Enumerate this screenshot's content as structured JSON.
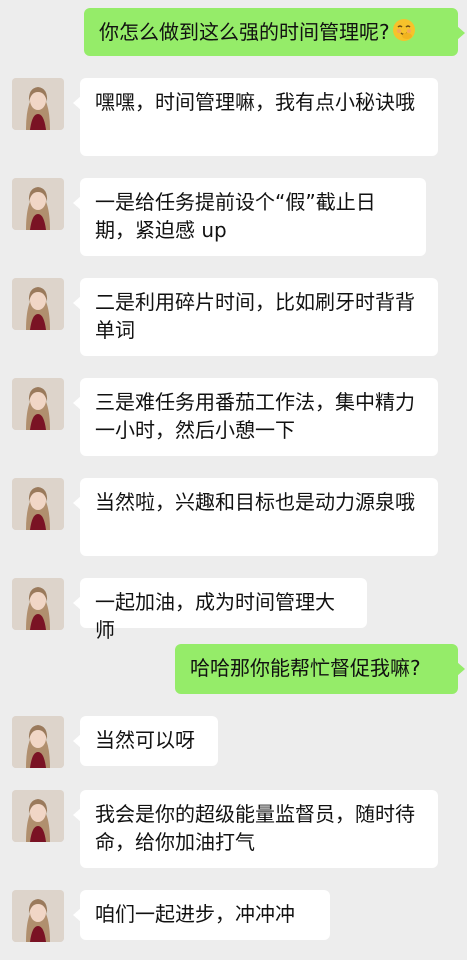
{
  "chat": {
    "messages": [
      {
        "sender": "me",
        "text": "你怎么做到这么强的时间管理呢?",
        "emoji": "smiling-face-with-hand-over-mouth-icon"
      },
      {
        "sender": "contact",
        "text": "嘿嘿，时间管理嘛，我有点小秘诀哦"
      },
      {
        "sender": "contact",
        "text": "一是给任务提前设个“假”截止日期，紧迫感 up"
      },
      {
        "sender": "contact",
        "text": "二是利用碎片时间，比如刷牙时背背单词"
      },
      {
        "sender": "contact",
        "text": "三是难任务用番茄工作法，集中精力一小时，然后小憩一下"
      },
      {
        "sender": "contact",
        "text": "当然啦，兴趣和目标也是动力源泉哦"
      },
      {
        "sender": "contact",
        "text": "一起加油，成为时间管理大师"
      },
      {
        "sender": "me",
        "text": "哈哈那你能帮忙督促我嘛?"
      },
      {
        "sender": "contact",
        "text": "当然可以呀"
      },
      {
        "sender": "contact",
        "text": "我会是你的超级能量监督员，随时待命，给你加油打气"
      },
      {
        "sender": "contact",
        "text": "咱们一起进步，冲冲冲"
      }
    ]
  },
  "colors": {
    "background": "#ededed",
    "incoming_bubble": "#ffffff",
    "outgoing_bubble": "#95ec69",
    "text": "#111111"
  }
}
